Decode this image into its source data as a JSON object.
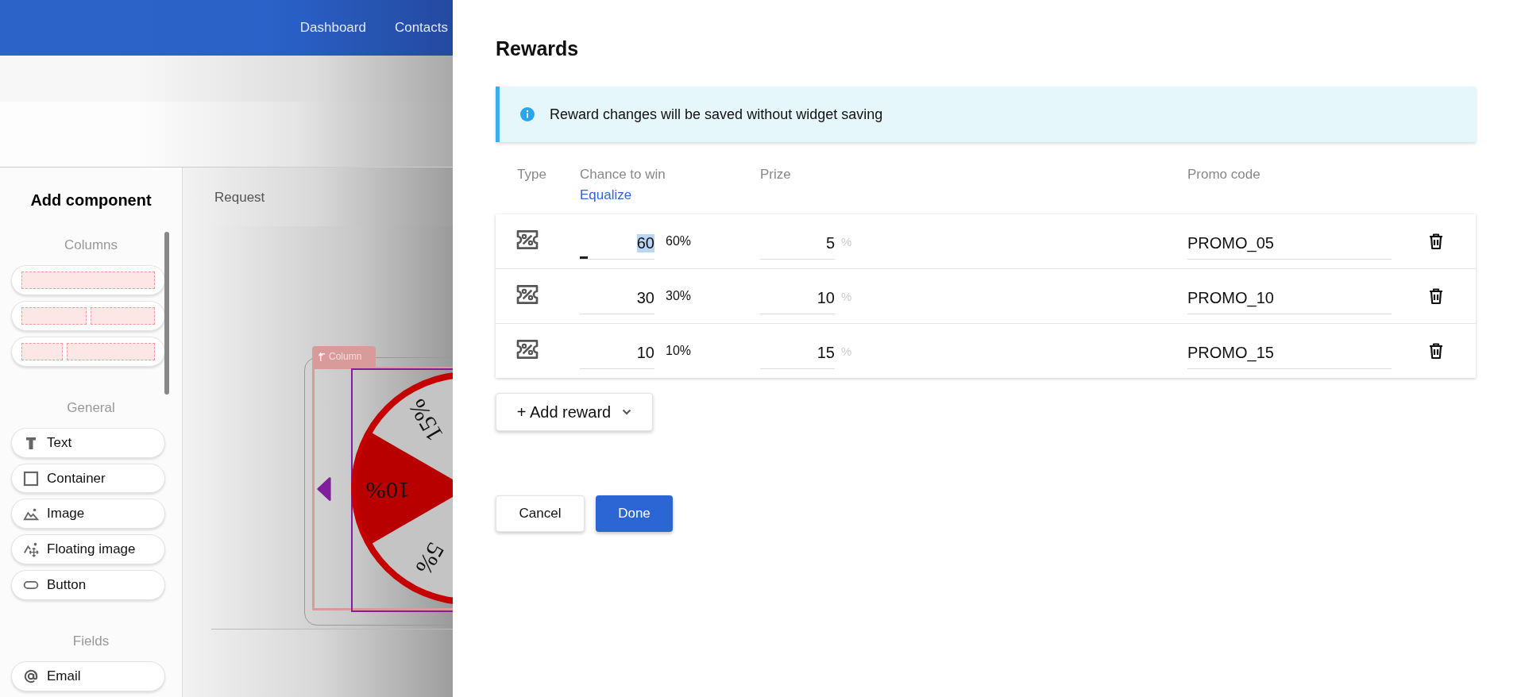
{
  "header": {
    "nav": [
      {
        "label": "Dashboard"
      },
      {
        "label": "Contacts"
      }
    ]
  },
  "sidebar": {
    "title": "Add component",
    "sections": [
      {
        "heading": "Columns",
        "items": [
          {
            "kind": "one-column"
          },
          {
            "kind": "two-columns"
          },
          {
            "kind": "narrow-wide"
          }
        ]
      },
      {
        "heading": "General",
        "items": [
          {
            "kind": "text",
            "label": "Text"
          },
          {
            "kind": "container",
            "label": "Container"
          },
          {
            "kind": "image",
            "label": "Image"
          },
          {
            "kind": "floating-image",
            "label": "Floating image"
          },
          {
            "kind": "button",
            "label": "Button"
          }
        ]
      },
      {
        "heading": "Fields",
        "items": [
          {
            "kind": "email",
            "label": "Email"
          }
        ]
      }
    ]
  },
  "canvas": {
    "title": "Request",
    "column_tag": "Column",
    "wheel_labels": [
      {
        "label": "10%",
        "highlighted": true
      },
      {
        "label": "15%",
        "highlighted": false
      },
      {
        "label": "5%",
        "highlighted": false
      }
    ]
  },
  "dialog": {
    "title": "Rewards",
    "notice": "Reward changes will be saved without widget saving",
    "columns": {
      "type": "Type",
      "chance": "Chance to win",
      "equalize": "Equalize",
      "prize": "Prize",
      "promo": "Promo code"
    },
    "rewards": [
      {
        "chance": "60",
        "chance_percent": "60%",
        "prize": "5",
        "prize_unit": "%",
        "promo_code": "PROMO_05",
        "focused": true
      },
      {
        "chance": "30",
        "chance_percent": "30%",
        "prize": "10",
        "prize_unit": "%",
        "promo_code": "PROMO_10",
        "focused": false
      },
      {
        "chance": "10",
        "chance_percent": "10%",
        "prize": "15",
        "prize_unit": "%",
        "promo_code": "PROMO_15",
        "focused": false
      }
    ],
    "add_button": "+ Add reward",
    "cancel": "Cancel",
    "done": "Done"
  }
}
